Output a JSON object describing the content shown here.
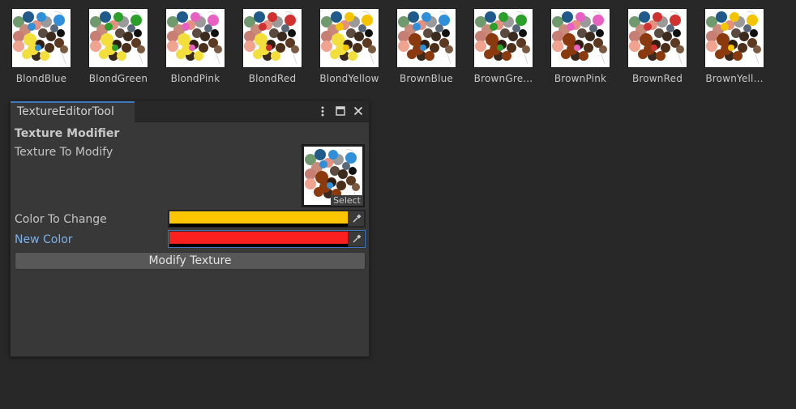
{
  "assets": [
    {
      "label": "BlondBlue",
      "hair": "#f2df3b",
      "eyes": "#2f8fd8"
    },
    {
      "label": "BlondGreen",
      "hair": "#f2df3b",
      "eyes": "#2aa02a"
    },
    {
      "label": "BlondPink",
      "hair": "#f2df3b",
      "eyes": "#e860c2"
    },
    {
      "label": "BlondRed",
      "hair": "#f2df3b",
      "eyes": "#d03232"
    },
    {
      "label": "BlondYellow",
      "hair": "#f2df3b",
      "eyes": "#f5c400"
    },
    {
      "label": "BrownBlue",
      "hair": "#8a3a0e",
      "eyes": "#2f8fd8"
    },
    {
      "label": "BrownGre...",
      "hair": "#8a3a0e",
      "eyes": "#2aa02a"
    },
    {
      "label": "BrownPink",
      "hair": "#8a3a0e",
      "eyes": "#e860c2"
    },
    {
      "label": "BrownRed",
      "hair": "#8a3a0e",
      "eyes": "#d03232"
    },
    {
      "label": "BrownYell...",
      "hair": "#8a3a0e",
      "eyes": "#f5c400"
    }
  ],
  "window": {
    "tab_title": "TextureEditorTool",
    "menu_icon": "kebab-menu-icon",
    "maximize_icon": "maximize-icon",
    "close_icon": "close-icon"
  },
  "editor": {
    "section_title": "Texture Modifier",
    "texture_label": "Texture To Modify",
    "texture_select": "Select",
    "texture_preview": {
      "hair": "#8a3a0e",
      "eyes": "#2f8fd8"
    },
    "color_to_change_label": "Color To Change",
    "color_to_change": "#fec600",
    "new_color_label": "New Color",
    "new_color": "#fb2020",
    "eyedropper_icon": "eyedropper-icon",
    "modify_button": "Modify Texture"
  },
  "colors": {
    "accent": "#3a79bb",
    "window_bg": "#383838",
    "editor_bg": "#282828"
  }
}
